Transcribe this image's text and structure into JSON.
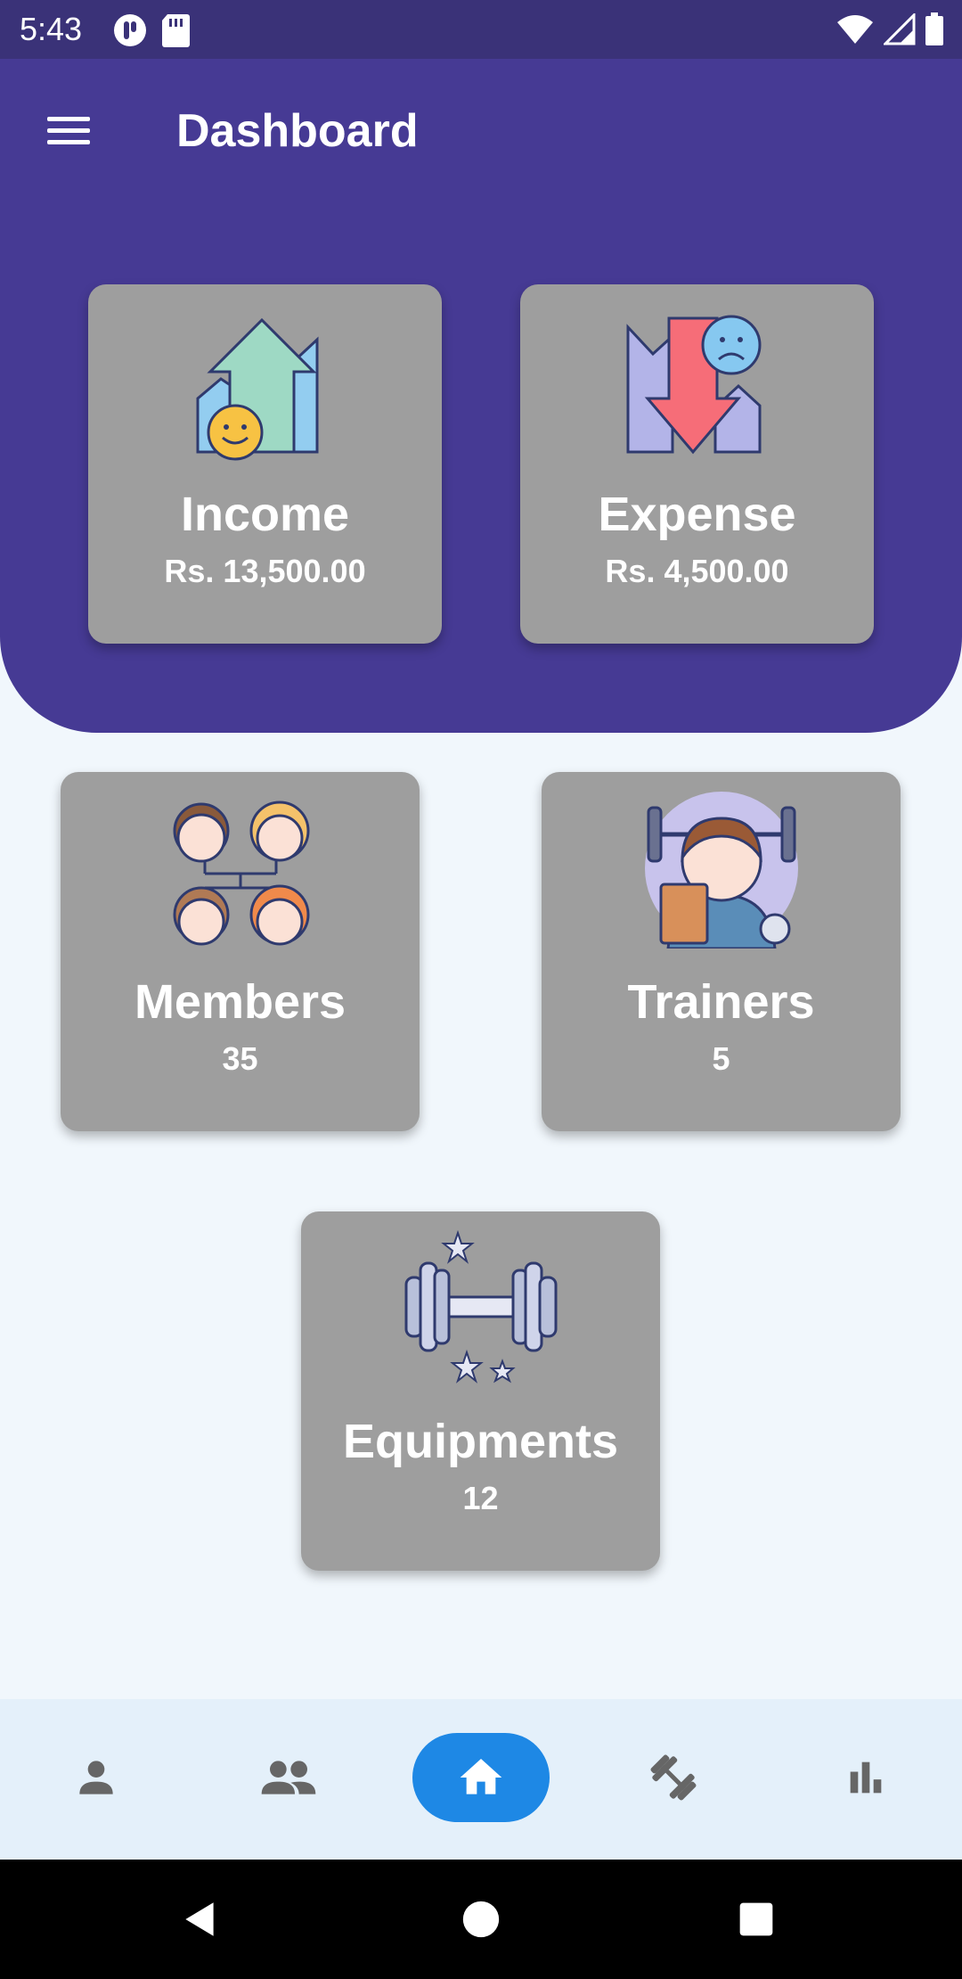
{
  "status_bar": {
    "time": "5:43"
  },
  "header": {
    "title": "Dashboard",
    "menu_icon": "hamburger-menu-icon",
    "background_color": "#463a94"
  },
  "cards": {
    "income": {
      "title": "Income",
      "value": "Rs. 13,500.00",
      "icon": "income-chart-icon"
    },
    "expense": {
      "title": "Expense",
      "value": "Rs. 4,500.00",
      "icon": "expense-chart-icon"
    },
    "members": {
      "title": "Members",
      "value": "35",
      "icon": "members-group-icon"
    },
    "trainers": {
      "title": "Trainers",
      "value": "5",
      "icon": "trainer-icon"
    },
    "equipments": {
      "title": "Equipments",
      "value": "12",
      "icon": "dumbbell-icon"
    }
  },
  "bottom_nav": {
    "items": [
      {
        "icon": "person-icon",
        "active": false
      },
      {
        "icon": "group-icon",
        "active": false
      },
      {
        "icon": "home-icon",
        "active": true
      },
      {
        "icon": "fitness-icon",
        "active": false
      },
      {
        "icon": "bar-chart-icon",
        "active": false
      }
    ],
    "active_color": "#1e88e5"
  },
  "system_nav": {
    "icons": [
      "back-icon",
      "home-circle-icon",
      "recents-icon"
    ]
  }
}
